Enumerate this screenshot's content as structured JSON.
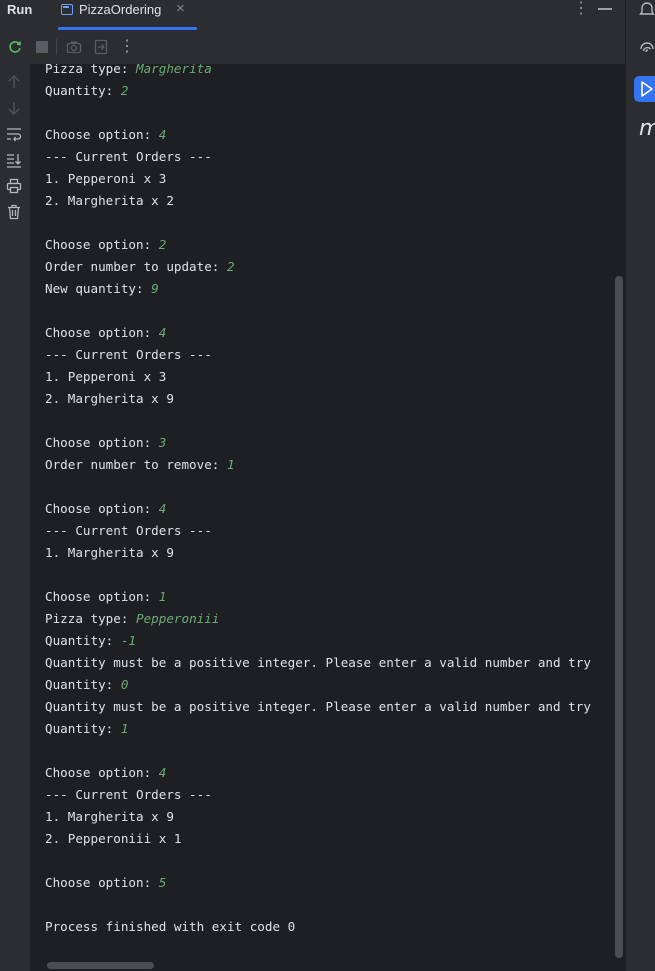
{
  "window": {
    "panel_title": "Run",
    "tab_label": "PizzaOrdering"
  },
  "icons": {
    "close": "close-icon",
    "more": "more-vertical-icon",
    "minimize": "minimize-icon",
    "rerun": "rerun-icon",
    "stop": "stop-icon",
    "screenshot": "camera-icon",
    "restore": "exit-icon",
    "up": "arrow-up-icon",
    "down": "arrow-down-icon",
    "wrap": "soft-wrap-icon",
    "scroll_end": "scroll-to-end-icon",
    "print": "print-icon",
    "trash": "trash-icon"
  },
  "colors": {
    "background": "#1e1f22",
    "panel": "#2b2d30",
    "accent": "#3574f0",
    "user_input": "#6aab73",
    "text": "#dfe1e5"
  },
  "right_strip": {
    "letter": "m"
  },
  "console": {
    "lines": [
      {
        "text": "Pizza type: ",
        "input": "Margherita"
      },
      {
        "text": "Quantity: ",
        "input": "2"
      },
      {
        "text": "",
        "input": ""
      },
      {
        "text": "Choose option: ",
        "input": "4"
      },
      {
        "text": "--- Current Orders ---",
        "input": ""
      },
      {
        "text": "1. Pepperoni x 3",
        "input": ""
      },
      {
        "text": "2. Margherita x 2",
        "input": ""
      },
      {
        "text": "",
        "input": ""
      },
      {
        "text": "Choose option: ",
        "input": "2"
      },
      {
        "text": "Order number to update: ",
        "input": "2"
      },
      {
        "text": "New quantity: ",
        "input": "9"
      },
      {
        "text": "",
        "input": ""
      },
      {
        "text": "Choose option: ",
        "input": "4"
      },
      {
        "text": "--- Current Orders ---",
        "input": ""
      },
      {
        "text": "1. Pepperoni x 3",
        "input": ""
      },
      {
        "text": "2. Margherita x 9",
        "input": ""
      },
      {
        "text": "",
        "input": ""
      },
      {
        "text": "Choose option: ",
        "input": "3"
      },
      {
        "text": "Order number to remove: ",
        "input": "1"
      },
      {
        "text": "",
        "input": ""
      },
      {
        "text": "Choose option: ",
        "input": "4"
      },
      {
        "text": "--- Current Orders ---",
        "input": ""
      },
      {
        "text": "1. Margherita x 9",
        "input": ""
      },
      {
        "text": "",
        "input": ""
      },
      {
        "text": "Choose option: ",
        "input": "1"
      },
      {
        "text": "Pizza type: ",
        "input": "Pepperoniii"
      },
      {
        "text": "Quantity: ",
        "input": "-1"
      },
      {
        "text": "Quantity must be a positive integer. Please enter a valid number and try",
        "input": ""
      },
      {
        "text": "Quantity: ",
        "input": "0"
      },
      {
        "text": "Quantity must be a positive integer. Please enter a valid number and try",
        "input": ""
      },
      {
        "text": "Quantity: ",
        "input": "1"
      },
      {
        "text": "",
        "input": ""
      },
      {
        "text": "Choose option: ",
        "input": "4"
      },
      {
        "text": "--- Current Orders ---",
        "input": ""
      },
      {
        "text": "1. Margherita x 9",
        "input": ""
      },
      {
        "text": "2. Pepperoniii x 1",
        "input": ""
      },
      {
        "text": "",
        "input": ""
      },
      {
        "text": "Choose option: ",
        "input": "5"
      },
      {
        "text": "",
        "input": ""
      },
      {
        "text": "Process finished with exit code 0",
        "input": ""
      }
    ]
  }
}
